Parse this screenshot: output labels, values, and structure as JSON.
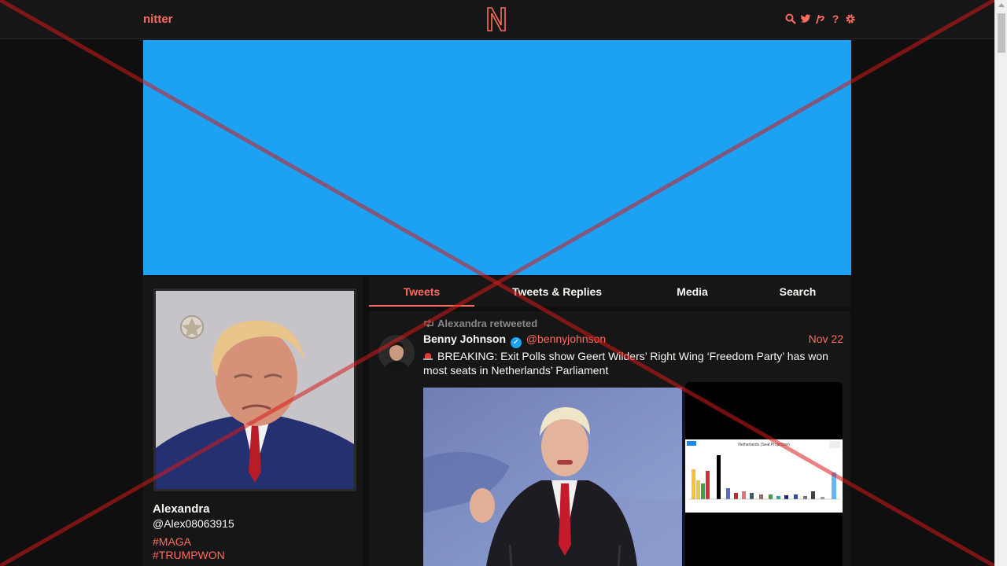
{
  "nav": {
    "brand": "nitter",
    "icons": [
      "search-icon",
      "twitter-bird-icon",
      "rss-icon",
      "help-icon",
      "gear-icon"
    ]
  },
  "colors": {
    "accent": "#ff6c60",
    "background": "#0f0f0f",
    "panel": "#161616",
    "banner": "#1da1f2"
  },
  "profile": {
    "name": "Alexandra",
    "handle": "@Alex08063915",
    "bio_tags": [
      "#MAGA",
      "#TRUMPWON"
    ]
  },
  "tabs": [
    {
      "label": "Tweets",
      "active": true
    },
    {
      "label": "Tweets & Replies",
      "active": false
    },
    {
      "label": "Media",
      "active": false
    },
    {
      "label": "Search",
      "active": false
    }
  ],
  "tweet": {
    "retweet_label": "Alexandra retweeted",
    "fullname": "Benny Johnson",
    "username": "@bennyjohnson",
    "date": "Nov 22",
    "text": "BREAKING: Exit Polls show Geert Wilders’ Right Wing ‘Freedom Party’ has won most seats in Netherlands’ Parliament",
    "chart_title": "Netherlands (Seat Projection)"
  }
}
